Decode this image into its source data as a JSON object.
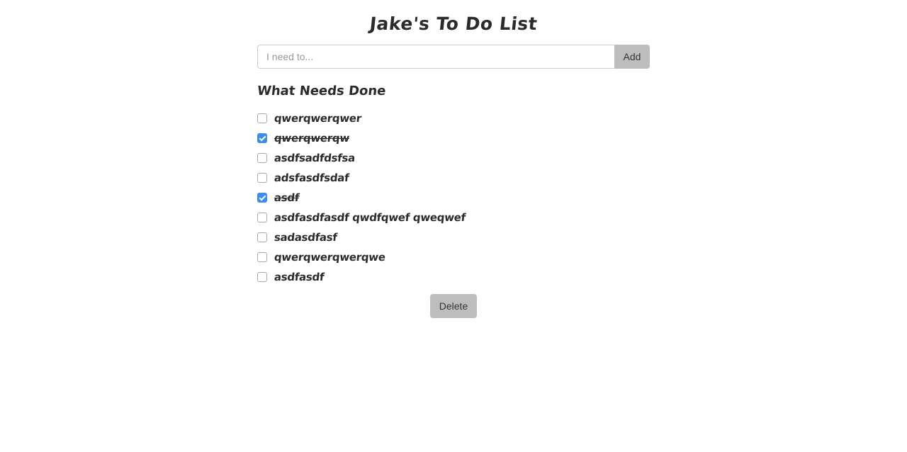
{
  "page": {
    "title": "Jake's To Do List"
  },
  "add_form": {
    "placeholder": "I need to...",
    "value": "",
    "add_label": "Add"
  },
  "section": {
    "heading": "What Needs Done"
  },
  "todos": [
    {
      "text": "qwerqwerqwer",
      "checked": false
    },
    {
      "text": "qwerqwerqw",
      "checked": true
    },
    {
      "text": "asdfsadfdsfsa",
      "checked": false
    },
    {
      "text": "adsfasdfsdaf",
      "checked": false
    },
    {
      "text": "asdf",
      "checked": true
    },
    {
      "text": "asdfasdfasdf qwdfqwef qweqwef",
      "checked": false
    },
    {
      "text": "sadasdfasf",
      "checked": false
    },
    {
      "text": "qwerqwerqwerqwe",
      "checked": false
    },
    {
      "text": "asdfasdf",
      "checked": false
    }
  ],
  "actions": {
    "delete_label": "Delete"
  },
  "colors": {
    "checkbox_checked": "#3b8eea",
    "button_bg": "#bdbdbd",
    "text": "#2b2b2b"
  }
}
